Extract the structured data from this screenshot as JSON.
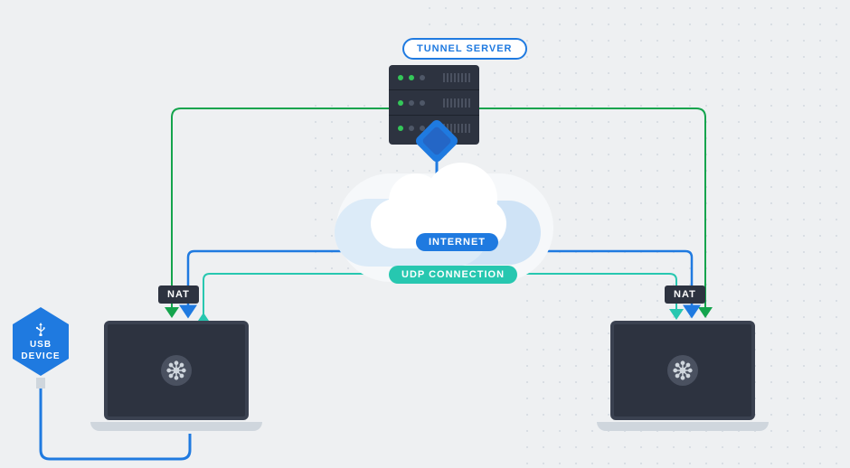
{
  "labels": {
    "tunnel_server": "TUNNEL SERVER",
    "internet": "INTERNET",
    "udp_connection": "UDP CONNECTION",
    "nat_left": "NAT",
    "nat_right": "NAT",
    "usb_line1": "USB",
    "usb_line2": "DEVICE"
  },
  "colors": {
    "blue": "#1f7ae0",
    "teal": "#27c7b0",
    "green": "#14a44d",
    "dark": "#2d3340"
  },
  "nodes": {
    "server": "tunnel-server",
    "laptop_left": "laptop-left",
    "laptop_right": "laptop-right",
    "cloud": "internet-cloud",
    "usb": "usb-device"
  }
}
